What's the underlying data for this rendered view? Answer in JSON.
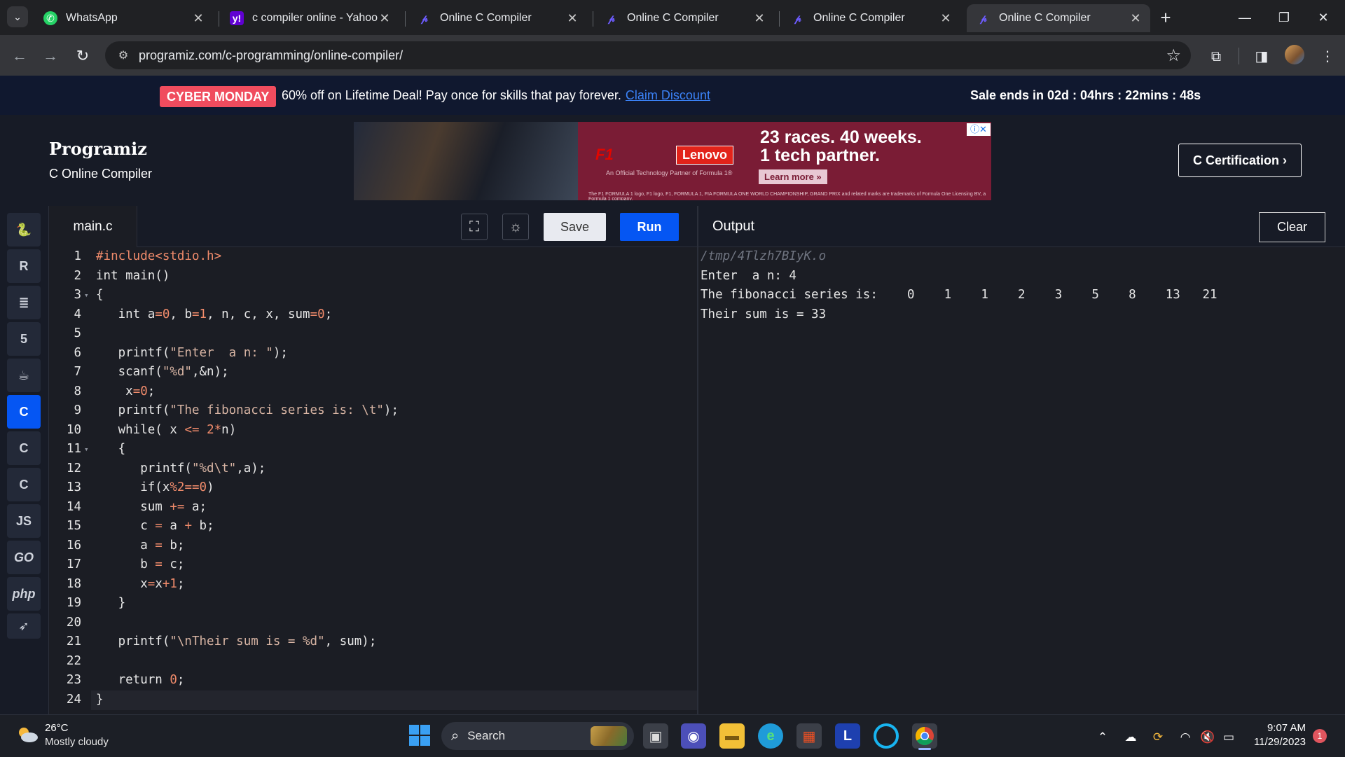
{
  "browser": {
    "tabs": [
      {
        "title": "WhatsApp",
        "icon": "whatsapp-icon",
        "active": false
      },
      {
        "title": "c compiler online - Yahoo S",
        "icon": "yahoo-icon",
        "active": false
      },
      {
        "title": "Online C Compiler",
        "icon": "programiz-icon",
        "active": false
      },
      {
        "title": "Online C Compiler",
        "icon": "programiz-icon",
        "active": false
      },
      {
        "title": "Online C Compiler",
        "icon": "programiz-icon",
        "active": false
      },
      {
        "title": "Online C Compiler",
        "icon": "programiz-icon",
        "active": true
      }
    ],
    "url": "programiz.com/c-programming/online-compiler/"
  },
  "promo": {
    "badge": "CYBER MONDAY",
    "text": "60% off on Lifetime Deal! Pay once for skills that pay forever.",
    "link": "Claim Discount",
    "sale": "Sale ends in 02d : 04hrs : 22mins : 48s"
  },
  "header": {
    "logo": "Programiz",
    "subtitle": "C Online Compiler",
    "cert_button": "C Certification ›"
  },
  "ad": {
    "headline1": "23 races. 40 weeks.",
    "headline2": "1 tech partner.",
    "brand": "Lenovo",
    "f1": "F1",
    "partner": "An Official Technology Partner of Formula 1®",
    "cta": "Learn more »",
    "fine_print": "The F1 FORMULA 1 logo, F1 logo, F1, FORMULA 1, FIA FORMULA ONE WORLD CHAMPIONSHIP, GRAND PRIX and related marks are trademarks of Formula One Licensing BV, a Formula 1 company."
  },
  "sidebar": {
    "languages": [
      {
        "name": "python",
        "icon": "python-icon",
        "glyph": "🐍",
        "active": false
      },
      {
        "name": "r",
        "icon": "r-icon",
        "glyph": "R",
        "active": false
      },
      {
        "name": "sql",
        "icon": "database-icon",
        "glyph": "≣",
        "active": false
      },
      {
        "name": "html",
        "icon": "html5-icon",
        "glyph": "5",
        "active": false
      },
      {
        "name": "java",
        "icon": "java-icon",
        "glyph": "☕",
        "active": false
      },
      {
        "name": "c",
        "icon": "c-icon",
        "glyph": "C",
        "active": true
      },
      {
        "name": "cpp",
        "icon": "cpp-icon",
        "glyph": "C",
        "active": false
      },
      {
        "name": "csharp",
        "icon": "csharp-icon",
        "glyph": "C",
        "active": false
      },
      {
        "name": "javascript",
        "icon": "js-icon",
        "glyph": "JS",
        "active": false
      },
      {
        "name": "go",
        "icon": "go-icon",
        "glyph": "GO",
        "active": false
      },
      {
        "name": "php",
        "icon": "php-icon",
        "glyph": "php",
        "active": false
      },
      {
        "name": "swift",
        "icon": "swift-icon",
        "glyph": "➶",
        "active": false
      }
    ]
  },
  "editor": {
    "filename": "main.c",
    "save_label": "Save",
    "run_label": "Run",
    "lines": [
      "#include<stdio.h>",
      "int main()",
      "{",
      "   int a=0, b=1, n, c, x, sum=0;",
      "",
      "   printf(\"Enter  a n: \");",
      "   scanf(\"%d\",&n);",
      "    x=0;",
      "   printf(\"The fibonacci series is: \\t\");",
      "   while( x <= 2*n)",
      "   {",
      "      printf(\"%d\\t\",a);",
      "      if(x%2==0)",
      "      sum += a;",
      "      c = a + b;",
      "      a = b;",
      "      b = c;",
      "      x=x+1;",
      "   }",
      "",
      "   printf(\"\\nTheir sum is = %d\", sum);",
      "",
      "   return 0;",
      "}"
    ],
    "fold_lines": [
      3,
      11
    ]
  },
  "output": {
    "title": "Output",
    "clear_label": "Clear",
    "lines": [
      "/tmp/4Tlzh7BIyK.o",
      "Enter  a n: 4",
      "The fibonacci series is:    0    1    1    2    3    5    8    13   21",
      "Their sum is = 33"
    ]
  },
  "taskbar": {
    "temperature": "26°C",
    "weather": "Mostly cloudy",
    "search_label": "Search",
    "time": "9:07 AM",
    "date": "11/29/2023",
    "notifications": "1"
  }
}
